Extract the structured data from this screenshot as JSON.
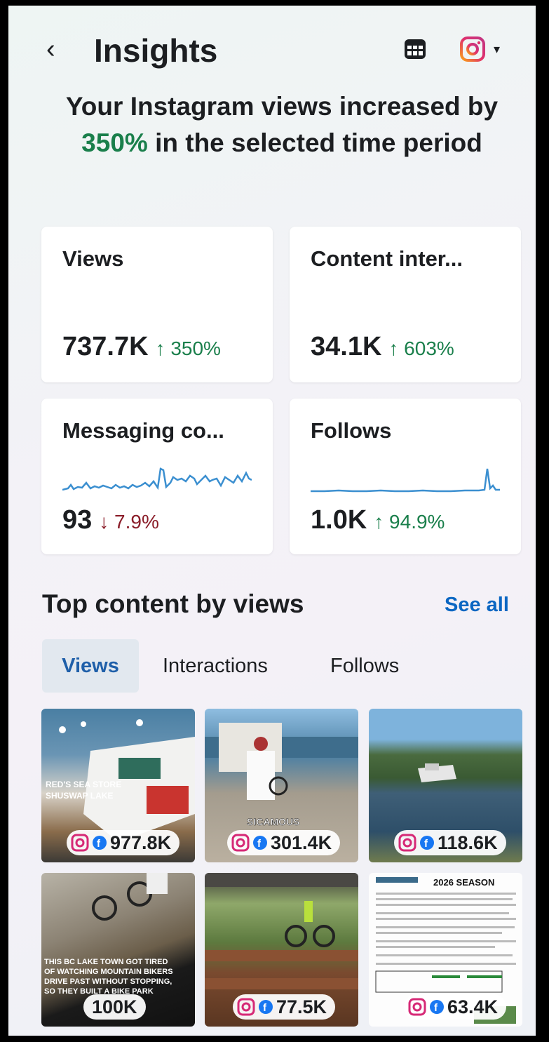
{
  "header": {
    "back_glyph": "‹",
    "title": "Insights",
    "icons": [
      "table-icon",
      "instagram-icon",
      "caret-down-icon"
    ],
    "caret_glyph": "▾"
  },
  "headline": {
    "prefix": "Your Instagram views increased by",
    "percent": "350%",
    "suffix": "in the selected time period"
  },
  "metrics": [
    {
      "title": "Views",
      "value": "737.7K",
      "change": "↑ 350%",
      "trend": "up"
    },
    {
      "title": "Content inter...",
      "value": "34.1K",
      "change": "↑ 603%",
      "trend": "up"
    },
    {
      "title": "Messaging co...",
      "value": "93",
      "change": "↓ 7.9%",
      "trend": "down"
    },
    {
      "title": "Follows",
      "value": "1.0K",
      "change": "↑ 94.9%",
      "trend": "up"
    }
  ],
  "colors": {
    "positive": "#1a7f4b",
    "negative": "#8a1c28",
    "link": "#0a66c2",
    "sparkline": "#3b8fd0"
  },
  "top_content": {
    "title": "Top content by views",
    "see_all": "See all",
    "tabs": [
      {
        "label": "Views",
        "active": true
      },
      {
        "label": "Interactions",
        "active": false
      },
      {
        "label": "Follows",
        "active": false
      }
    ],
    "items": [
      {
        "count": "977.8K",
        "overlay": "RED'S SEA STORE\nSHUSWAP LAKE"
      },
      {
        "count": "301.4K",
        "overlay": "SICAMOUS"
      },
      {
        "count": "118.6K",
        "overlay": ""
      },
      {
        "count": "100K",
        "overlay": "THIS BC LAKE TOWN GOT TIRED OF WATCHING MOUNTAIN BIKERS DRIVE PAST WITHOUT STOPPING, SO THEY BUILT A BIKE PARK"
      },
      {
        "count": "77.5K",
        "overlay": ""
      },
      {
        "count": "63.4K",
        "overlay": "2026 SEASON"
      }
    ]
  }
}
